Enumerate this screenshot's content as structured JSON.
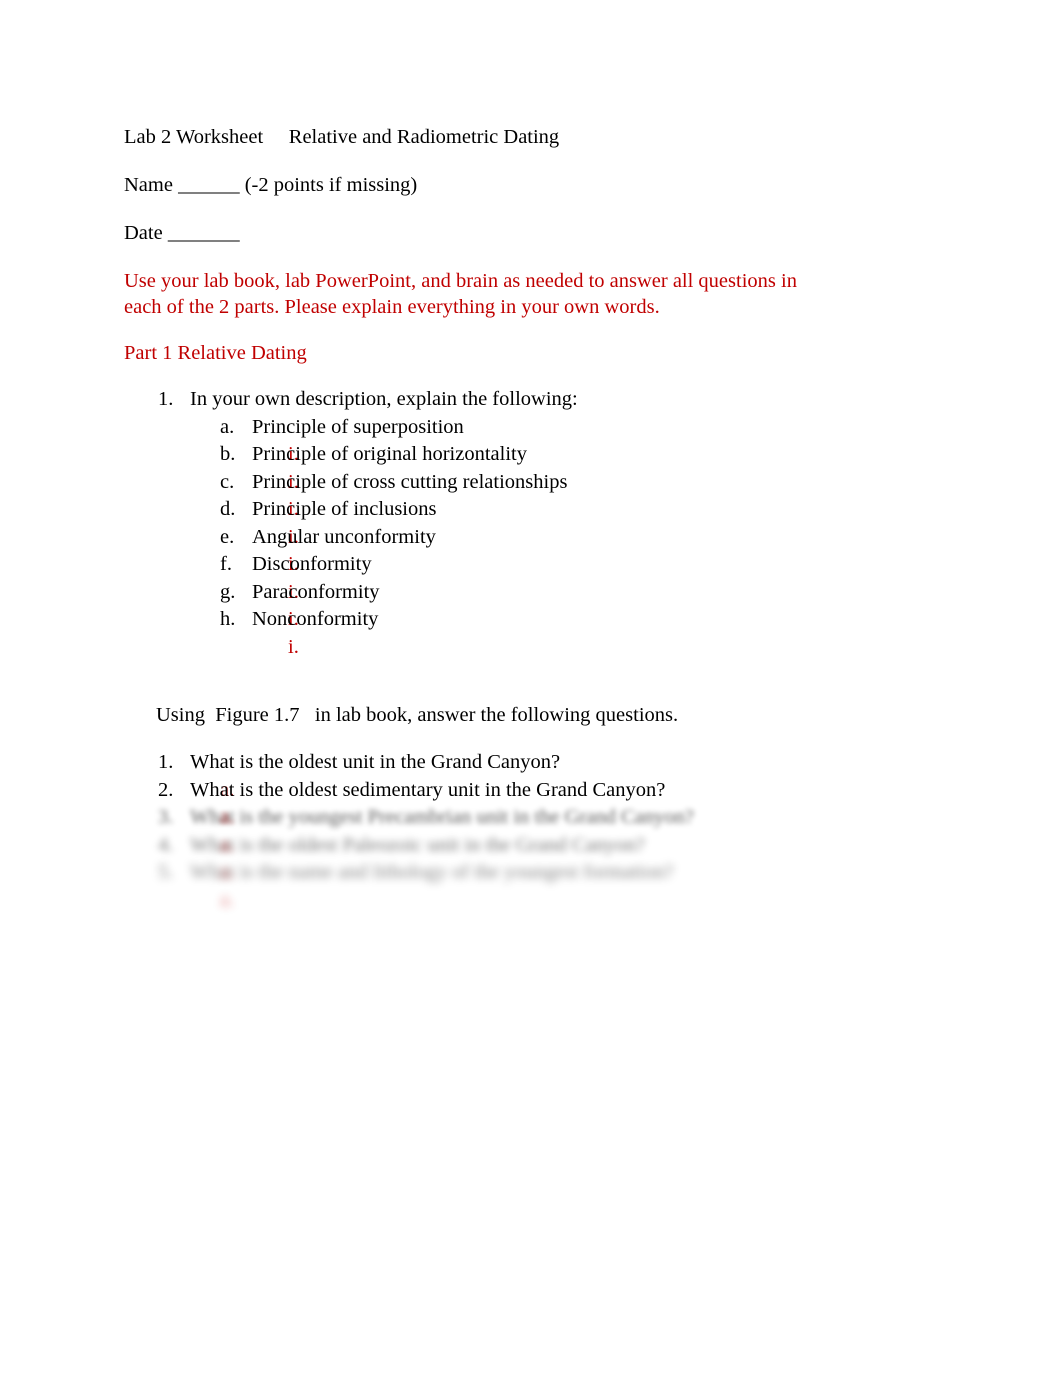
{
  "document": {
    "title_line": "Lab 2 Worksheet     Relative and Radiometric Dating",
    "name_line": "Name ______ (-2 points if missing)",
    "date_line": "Date _______",
    "instruction": "Use your lab book, lab PowerPoint, and brain as needed to answer all questions in each of the 2 parts. Please explain everything in your own words.",
    "part_heading": "Part 1 Relative Dating",
    "accent_color": "#C00000",
    "text_color": "#000000",
    "page_background": "#FFFFFF"
  },
  "question1": {
    "marker": "1.",
    "text": "In your own description, explain the following:",
    "subitems": [
      {
        "marker": "a.",
        "text": "Principle of superposition",
        "answer_marker": "i."
      },
      {
        "marker": "b.",
        "text": "Principle of original horizontality",
        "answer_marker": "i."
      },
      {
        "marker": "c.",
        "text": "Principle of cross cutting relationships",
        "answer_marker": "i."
      },
      {
        "marker": "d.",
        "text": "Principle of inclusions",
        "answer_marker": "i."
      },
      {
        "marker": "e.",
        "text": "Angular unconformity",
        "answer_marker": "i."
      },
      {
        "marker": "f.",
        "text": "Disconformity",
        "answer_marker": "i."
      },
      {
        "marker": "g.",
        "text": "Paraconformity",
        "answer_marker": "i."
      },
      {
        "marker": "h.",
        "text": "Nonconformity",
        "answer_marker": "i."
      }
    ]
  },
  "figure_section": {
    "intro": "Using  Figure 1.7   in lab book, answer the following questions.",
    "questions": [
      {
        "marker": "1.",
        "text": "What is the oldest unit in the Grand Canyon?",
        "answer_marker": "a.",
        "blurred": false
      },
      {
        "marker": "2.",
        "text": "What is the oldest sedimentary unit in the Grand Canyon?",
        "answer_marker": "a.",
        "blurred": true
      },
      {
        "marker": "3.",
        "text": "What is the youngest Precambrian unit in the Grand Canyon?",
        "answer_marker": "a.",
        "blurred": true
      },
      {
        "marker": "4.",
        "text": "What is the oldest Paleozoic unit in the Grand Canyon?",
        "answer_marker": "a.",
        "blurred": true
      },
      {
        "marker": "5.",
        "text": "What is the name and lithology of the youngest formation?",
        "answer_marker": "a.",
        "blurred": true
      }
    ]
  }
}
